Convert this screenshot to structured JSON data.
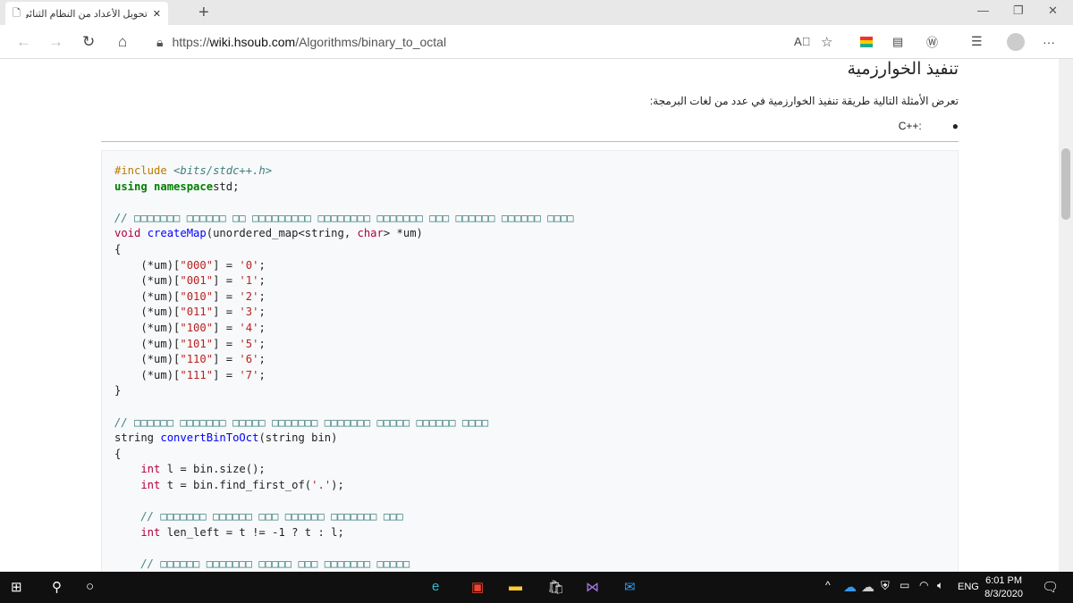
{
  "browser": {
    "tab_title": "تحويل الأعداد من النظام الثنائي إلى",
    "url_scheme": "https://",
    "url_host": "wiki.hsoub.com",
    "url_path": "/Algorithms/binary_to_octal",
    "new_tab": "+"
  },
  "page": {
    "heading": "تنفيذ الخوارزمية",
    "intro": "تعرض الأمثلة التالية طريقة تنفيذ الخوارزمية في عدد من لغات البرمجة:",
    "bullet": "C++:"
  },
  "code": [
    [
      [
        "pp",
        "#include "
      ],
      [
        "inc",
        "<bits/stdc++.h>"
      ]
    ],
    [
      [
        "kw",
        "using namespace"
      ],
      [
        "",
        "std;"
      ]
    ],
    [],
    [
      [
        "cm",
        "// □□□□□□□ □□□□□□ □□ □□□□□□□□□ □□□□□□□□ □□□□□□□ □□□ □□□□□□ □□□□□□ □□□□"
      ]
    ],
    [
      [
        "ty",
        "void "
      ],
      [
        "fn",
        "createMap"
      ],
      [
        "",
        "(unordered_map<string, "
      ],
      [
        "ty",
        "char"
      ],
      [
        "",
        "> *um)"
      ]
    ],
    [
      [
        "",
        "{"
      ]
    ],
    [
      [
        "",
        "    (*um)["
      ],
      [
        "st",
        "\"000\""
      ],
      [
        "",
        "] = "
      ],
      [
        "st",
        "'0'"
      ],
      [
        "",
        ";"
      ]
    ],
    [
      [
        "",
        "    (*um)["
      ],
      [
        "st",
        "\"001\""
      ],
      [
        "",
        "] = "
      ],
      [
        "st",
        "'1'"
      ],
      [
        "",
        ";"
      ]
    ],
    [
      [
        "",
        "    (*um)["
      ],
      [
        "st",
        "\"010\""
      ],
      [
        "",
        "] = "
      ],
      [
        "st",
        "'2'"
      ],
      [
        "",
        ";"
      ]
    ],
    [
      [
        "",
        "    (*um)["
      ],
      [
        "st",
        "\"011\""
      ],
      [
        "",
        "] = "
      ],
      [
        "st",
        "'3'"
      ],
      [
        "",
        ";"
      ]
    ],
    [
      [
        "",
        "    (*um)["
      ],
      [
        "st",
        "\"100\""
      ],
      [
        "",
        "] = "
      ],
      [
        "st",
        "'4'"
      ],
      [
        "",
        ";"
      ]
    ],
    [
      [
        "",
        "    (*um)["
      ],
      [
        "st",
        "\"101\""
      ],
      [
        "",
        "] = "
      ],
      [
        "st",
        "'5'"
      ],
      [
        "",
        ";"
      ]
    ],
    [
      [
        "",
        "    (*um)["
      ],
      [
        "st",
        "\"110\""
      ],
      [
        "",
        "] = "
      ],
      [
        "st",
        "'6'"
      ],
      [
        "",
        ";"
      ]
    ],
    [
      [
        "",
        "    (*um)["
      ],
      [
        "st",
        "\"111\""
      ],
      [
        "",
        "] = "
      ],
      [
        "st",
        "'7'"
      ],
      [
        "",
        ";"
      ]
    ],
    [
      [
        "",
        "}"
      ]
    ],
    [],
    [
      [
        "cm",
        "// □□□□□□ □□□□□□□ □□□□□ □□□□□□□ □□□□□□□ □□□□□ □□□□□□ □□□□"
      ]
    ],
    [
      [
        "",
        "string "
      ],
      [
        "fn",
        "convertBinToOct"
      ],
      [
        "",
        "(string bin)"
      ]
    ],
    [
      [
        "",
        "{"
      ]
    ],
    [
      [
        "ty",
        "    int "
      ],
      [
        "",
        "l = bin.size();"
      ]
    ],
    [
      [
        "ty",
        "    int "
      ],
      [
        "",
        "t = bin.find_first_of("
      ],
      [
        "st",
        "'.'"
      ],
      [
        "",
        ");"
      ]
    ],
    [],
    [
      [
        "cm",
        "    // □□□□□□□ □□□□□□ □□□ □□□□□□ □□□□□□□ □□□"
      ]
    ],
    [
      [
        "ty",
        "    int "
      ],
      [
        "",
        "len_left = t != -1 ? t : l;"
      ]
    ],
    [],
    [
      [
        "cm",
        "    // □□□□□□ □□□□□□□ □□□□□ □□□ □□□□□□□ □□□□□"
      ]
    ]
  ],
  "taskbar": {
    "time": "6:01 PM",
    "date": "8/3/2020",
    "lang": "ENG"
  }
}
